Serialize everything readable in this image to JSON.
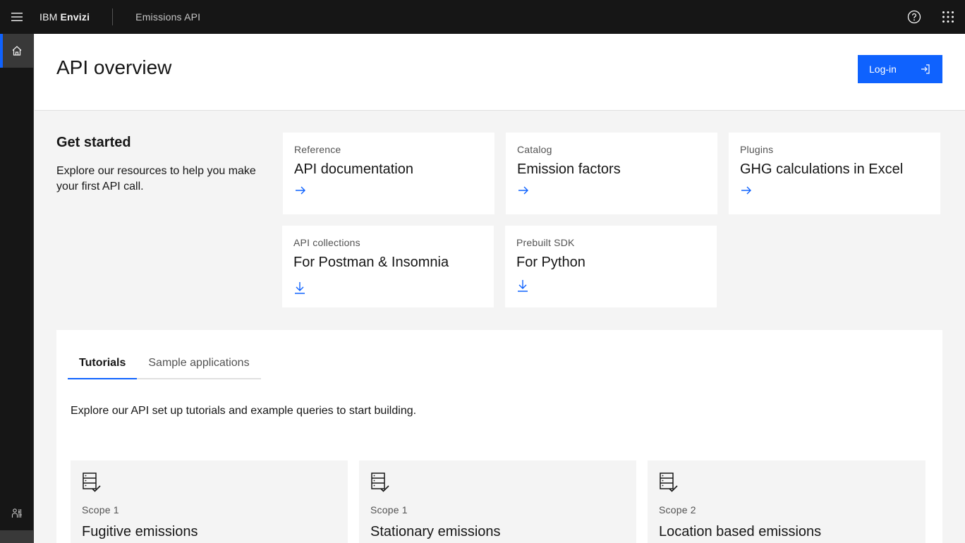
{
  "header": {
    "brand_prefix": "IBM",
    "brand_name": "Envizi",
    "product": "Emissions API"
  },
  "page": {
    "title": "API overview",
    "login_label": "Log-in"
  },
  "get_started": {
    "title": "Get started",
    "description": "Explore our resources to help you make your first API call.",
    "tiles": [
      {
        "eyebrow": "Reference",
        "title": "API documentation",
        "icon": "arrow-right-icon"
      },
      {
        "eyebrow": "Catalog",
        "title": "Emission factors",
        "icon": "arrow-right-icon"
      },
      {
        "eyebrow": "Plugins",
        "title": "GHG calculations in Excel",
        "icon": "arrow-right-icon"
      },
      {
        "eyebrow": "API collections",
        "title": "For Postman & Insomnia",
        "icon": "download-icon"
      },
      {
        "eyebrow": "Prebuilt SDK",
        "title": "For Python",
        "icon": "download-icon"
      }
    ]
  },
  "tutorials": {
    "tabs": [
      "Tutorials",
      "Sample applications"
    ],
    "active_tab": "Tutorials",
    "description": "Explore our API set up tutorials and example queries to start building.",
    "cards": [
      {
        "eyebrow": "Scope 1",
        "title": "Fugitive emissions",
        "icon": "data-check-icon"
      },
      {
        "eyebrow": "Scope 1",
        "title": "Stationary emissions",
        "icon": "data-check-icon"
      },
      {
        "eyebrow": "Scope 2",
        "title": "Location based emissions",
        "icon": "data-check-icon"
      }
    ]
  },
  "colors": {
    "accent": "#0f62fe",
    "shell": "#161616",
    "background": "#f4f4f4"
  }
}
